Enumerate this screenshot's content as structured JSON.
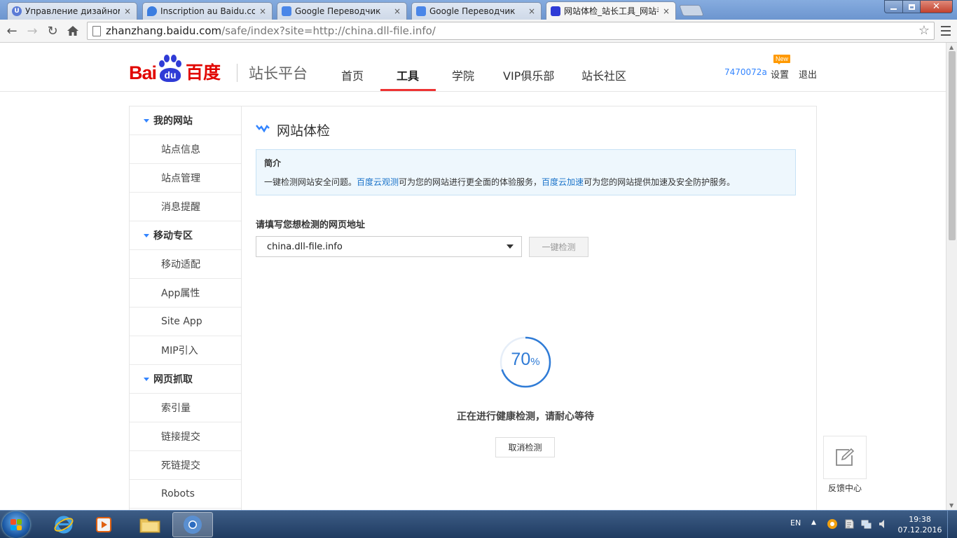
{
  "browser": {
    "tabs": [
      {
        "title": "Управление дизайном - ",
        "favicon_color": "#5b7bd6",
        "favicon_letter": "U"
      },
      {
        "title": "Inscription au Baidu.com,",
        "favicon_color": "#3b7de0",
        "favicon_letter": ""
      },
      {
        "title": "Google Переводчик",
        "favicon_color": "#4a86e8",
        "favicon_letter": ""
      },
      {
        "title": "Google Переводчик",
        "favicon_color": "#4a86e8",
        "favicon_letter": ""
      },
      {
        "title": "网站体检_站长工具_网站手",
        "favicon_color": "#2f3bd6",
        "favicon_letter": ""
      }
    ],
    "close_glyph": "×",
    "url_domain": "zhanzhang.baidu.com",
    "url_path": "/safe/index?site=http://china.dll-file.info/"
  },
  "header": {
    "logo_bai": "Bai",
    "logo_du": "du",
    "logo_cn": "百度",
    "platform": "站长平台",
    "nav": [
      "首页",
      "工具",
      "学院",
      "VIP俱乐部",
      "站长社区"
    ],
    "active_nav_index": 1,
    "user_id": "7470072a",
    "settings": "设置",
    "new_badge": "New",
    "logout": "退出"
  },
  "sidebar": {
    "groups": [
      {
        "title": "我的网站",
        "items": [
          "站点信息",
          "站点管理",
          "消息提醒"
        ]
      },
      {
        "title": "移动专区",
        "items": [
          "移动适配",
          "App属性",
          "Site App",
          "MIP引入"
        ]
      },
      {
        "title": "网页抓取",
        "items": [
          "索引量",
          "链接提交",
          "死链提交",
          "Robots"
        ]
      }
    ]
  },
  "main": {
    "title": "网站体检",
    "intro": {
      "title": "简介",
      "text_1": "一键检测网站安全问题。",
      "link_1": "百度云观测",
      "text_2": "可为您的网站进行更全面的体验服务，",
      "link_2": "百度云加速",
      "text_3": "可为您的网站提供加速及安全防护服务。"
    },
    "url_label": "请填写您想检测的网页地址",
    "url_value": "china.dll-file.info",
    "check_button": "一键检测",
    "progress_value": "70",
    "progress_unit": "%",
    "progress_fraction": 0.7,
    "status_text": "正在进行健康检测，请耐心等待",
    "cancel_button": "取消检测"
  },
  "feedback": {
    "label": "反馈中心"
  },
  "taskbar": {
    "lang": "EN",
    "time": "19:38",
    "date": "07.12.2016"
  },
  "colors": {
    "baidu_red": "#e10601",
    "baidu_blue": "#2f3bd6",
    "link_blue": "#1a73c9",
    "progress_blue": "#2f7bd6",
    "nav_active_underline": "#e33"
  }
}
